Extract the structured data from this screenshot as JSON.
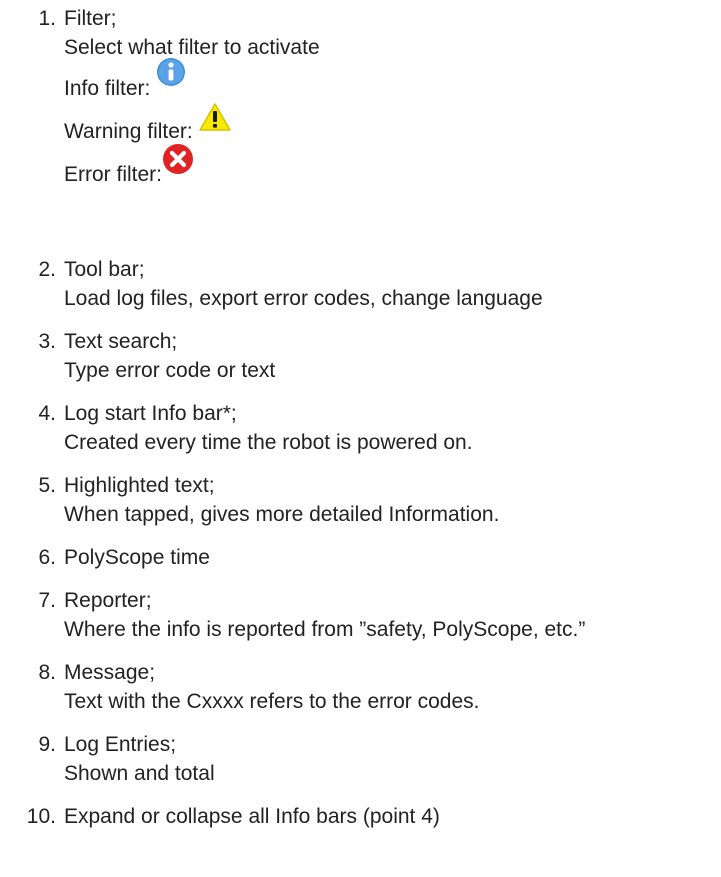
{
  "items": [
    {
      "number": "1.",
      "title": "Filter;",
      "description": "Select what filter to activate",
      "filters": [
        {
          "label": "Info filter:",
          "icon": "info-icon",
          "color": "#4a90d9"
        },
        {
          "label": "Warning filter:",
          "icon": "warning-icon",
          "color": "#f5e600"
        },
        {
          "label": "Error filter:",
          "icon": "error-icon",
          "color": "#e52222"
        }
      ]
    },
    {
      "number": "2.",
      "title": "Tool bar;",
      "description": "Load log files, export error codes, change language"
    },
    {
      "number": "3.",
      "title": "Text search;",
      "description": "Type error code or text"
    },
    {
      "number": "4.",
      "title": "Log start Info bar*;",
      "description": "Created every time the robot is powered on."
    },
    {
      "number": "5.",
      "title": "Highlighted text;",
      "description": "When tapped, gives more detailed Information."
    },
    {
      "number": "6.",
      "title": "PolyScope time"
    },
    {
      "number": "7.",
      "title": "Reporter;",
      "description": "Where the info is reported from ”safety, PolyScope, etc.”"
    },
    {
      "number": "8.",
      "title": "Message;",
      "description": "Text with the Cxxxx refers to the error codes."
    },
    {
      "number": "9.",
      "title": "Log Entries;",
      "description": "Shown and total"
    },
    {
      "number": "10.",
      "title": "Expand or collapse all Info bars (point 4)"
    }
  ]
}
